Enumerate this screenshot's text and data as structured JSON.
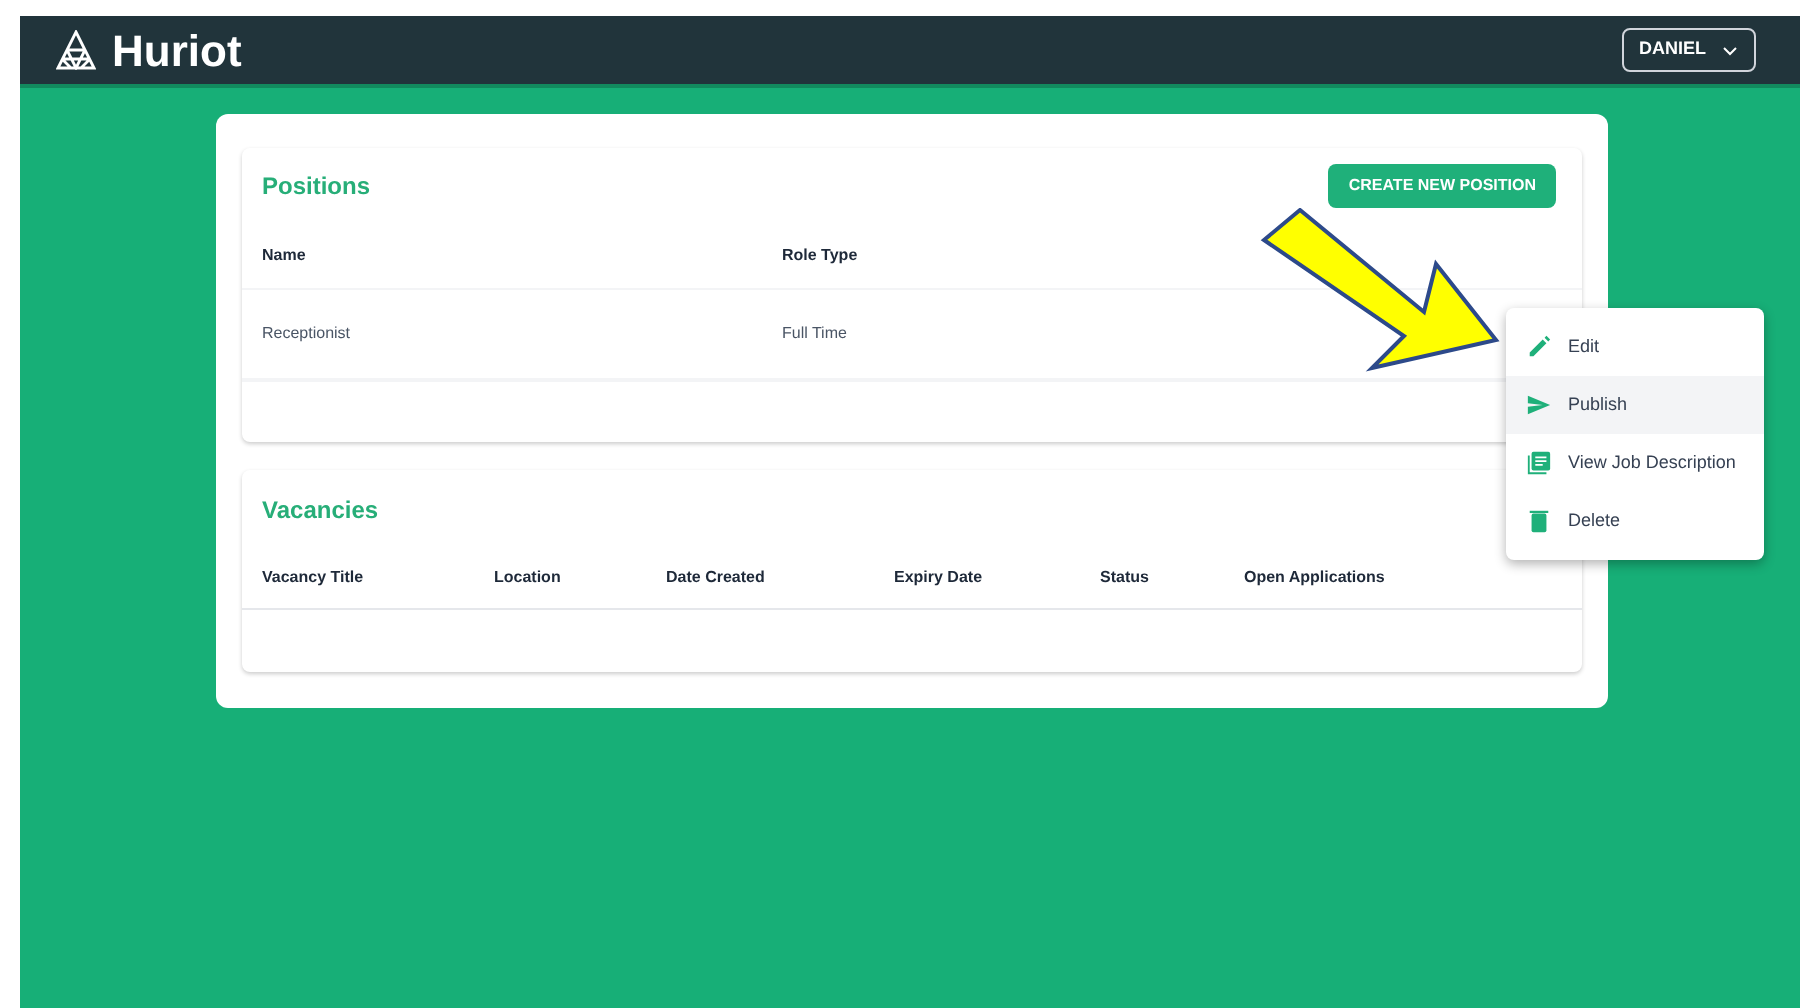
{
  "app": {
    "logo_text": "Huriot",
    "user_button": "DANIEL"
  },
  "positions": {
    "title": "Positions",
    "create_button": "CREATE NEW POSITION",
    "columns": [
      "Name",
      "Role Type"
    ],
    "rows": [
      {
        "cells": [
          "Receptionist",
          "Full Time"
        ]
      }
    ]
  },
  "vacancies": {
    "title": "Vacancies",
    "columns": [
      "Vacancy Title",
      "Location",
      "Date Created",
      "Expiry Date",
      "Status",
      "Open Applications"
    ]
  },
  "context_menu": {
    "items": [
      {
        "kind": "edit",
        "label": "Edit",
        "selected": false
      },
      {
        "kind": "publish",
        "label": "Publish",
        "selected": true
      },
      {
        "kind": "view",
        "label": "View Job Description",
        "selected": false
      },
      {
        "kind": "delete",
        "label": "Delete",
        "selected": false
      }
    ]
  }
}
